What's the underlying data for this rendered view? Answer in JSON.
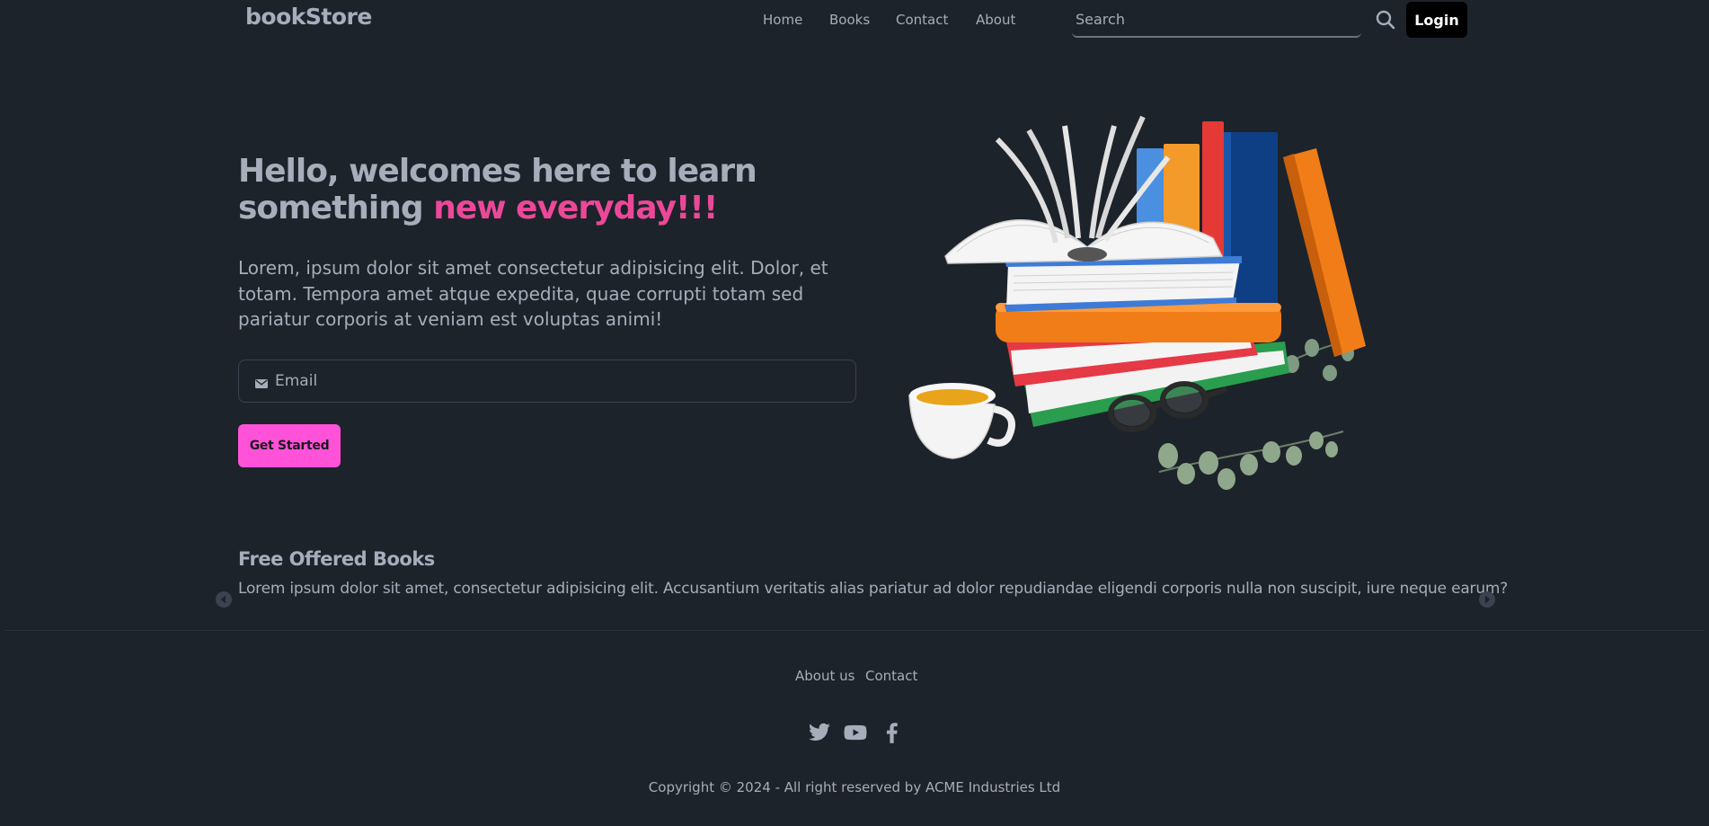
{
  "navbar": {
    "brand": "bookStore",
    "links": [
      "Home",
      "Books",
      "Contact",
      "About"
    ],
    "search_placeholder": "Search",
    "login_label": "Login"
  },
  "hero": {
    "title_main": "Hello, welcomes here to learn something ",
    "title_accent": "new everyday!!!",
    "description": "Lorem, ipsum dolor sit amet consectetur adipisicing elit. Dolor, et totam. Tempora amet atque expedita, quae corrupti totam sed pariatur corporis at veniam est voluptas animi!",
    "email_placeholder": "Email",
    "cta_label": "Get Started"
  },
  "free_books": {
    "title": "Free Offered Books",
    "description": "Lorem ipsum dolor sit amet, consectetur adipisicing elit. Accusantium veritatis alias pariatur ad dolor repudiandae eligendi corporis nulla non suscipit, iure neque earum?"
  },
  "footer": {
    "links": [
      "About us",
      "Contact"
    ],
    "social_icons": [
      "twitter-icon",
      "youtube-icon",
      "facebook-icon"
    ],
    "copyright": "Copyright © 2024 - All right reserved by ACME Industries Ltd"
  },
  "colors": {
    "background": "#1d232a",
    "text": "#a6adbb",
    "accent": "#ec4899",
    "cta": "#ff52d9",
    "login_bg": "#000000"
  }
}
